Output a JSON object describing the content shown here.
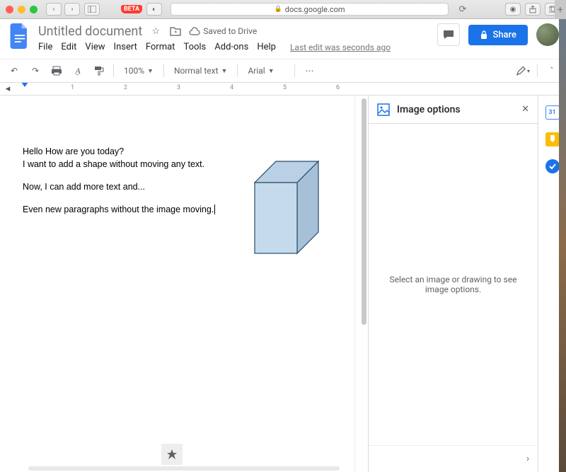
{
  "browser": {
    "url": "docs.google.com",
    "beta": "BETA"
  },
  "header": {
    "title": "Untitled document",
    "saved": "Saved to Drive",
    "last_edit": "Last edit was seconds ago",
    "share": "Share"
  },
  "menus": {
    "file": "File",
    "edit": "Edit",
    "view": "View",
    "insert": "Insert",
    "format": "Format",
    "tools": "Tools",
    "addons": "Add-ons",
    "help": "Help"
  },
  "toolbar": {
    "zoom": "100%",
    "style": "Normal text",
    "font": "Arial"
  },
  "ruler": {
    "marks": [
      "1",
      "2",
      "3",
      "4",
      "5",
      "6"
    ]
  },
  "document": {
    "line1": "Hello How are you today?",
    "line2": "I want to add a shape without moving any text.",
    "line3": "Now, I can add more text and...",
    "line4": "Even new paragraphs without the image moving."
  },
  "sidebar": {
    "title": "Image options",
    "placeholder": "Select an image or drawing to see image options."
  },
  "rail": {
    "calendar": "31"
  }
}
